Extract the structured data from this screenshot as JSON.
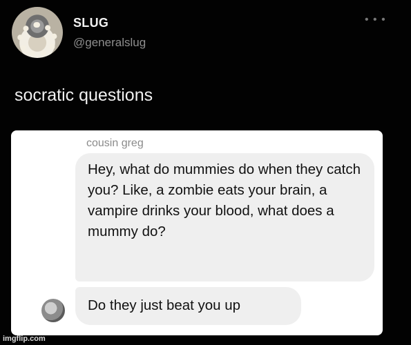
{
  "tweet": {
    "author_name": "SLUG",
    "author_handle": "@generalslug",
    "more_icon": "ellipsis-icon",
    "text": "socratic questions"
  },
  "screenshot": {
    "sender_name": "cousin greg",
    "messages": [
      "Hey, what do mummies do when they catch you? Like, a zombie eats your brain, a vampire drinks your blood, what does a mummy do?",
      "Do they just beat you up"
    ]
  },
  "watermark": "imgflip.com"
}
